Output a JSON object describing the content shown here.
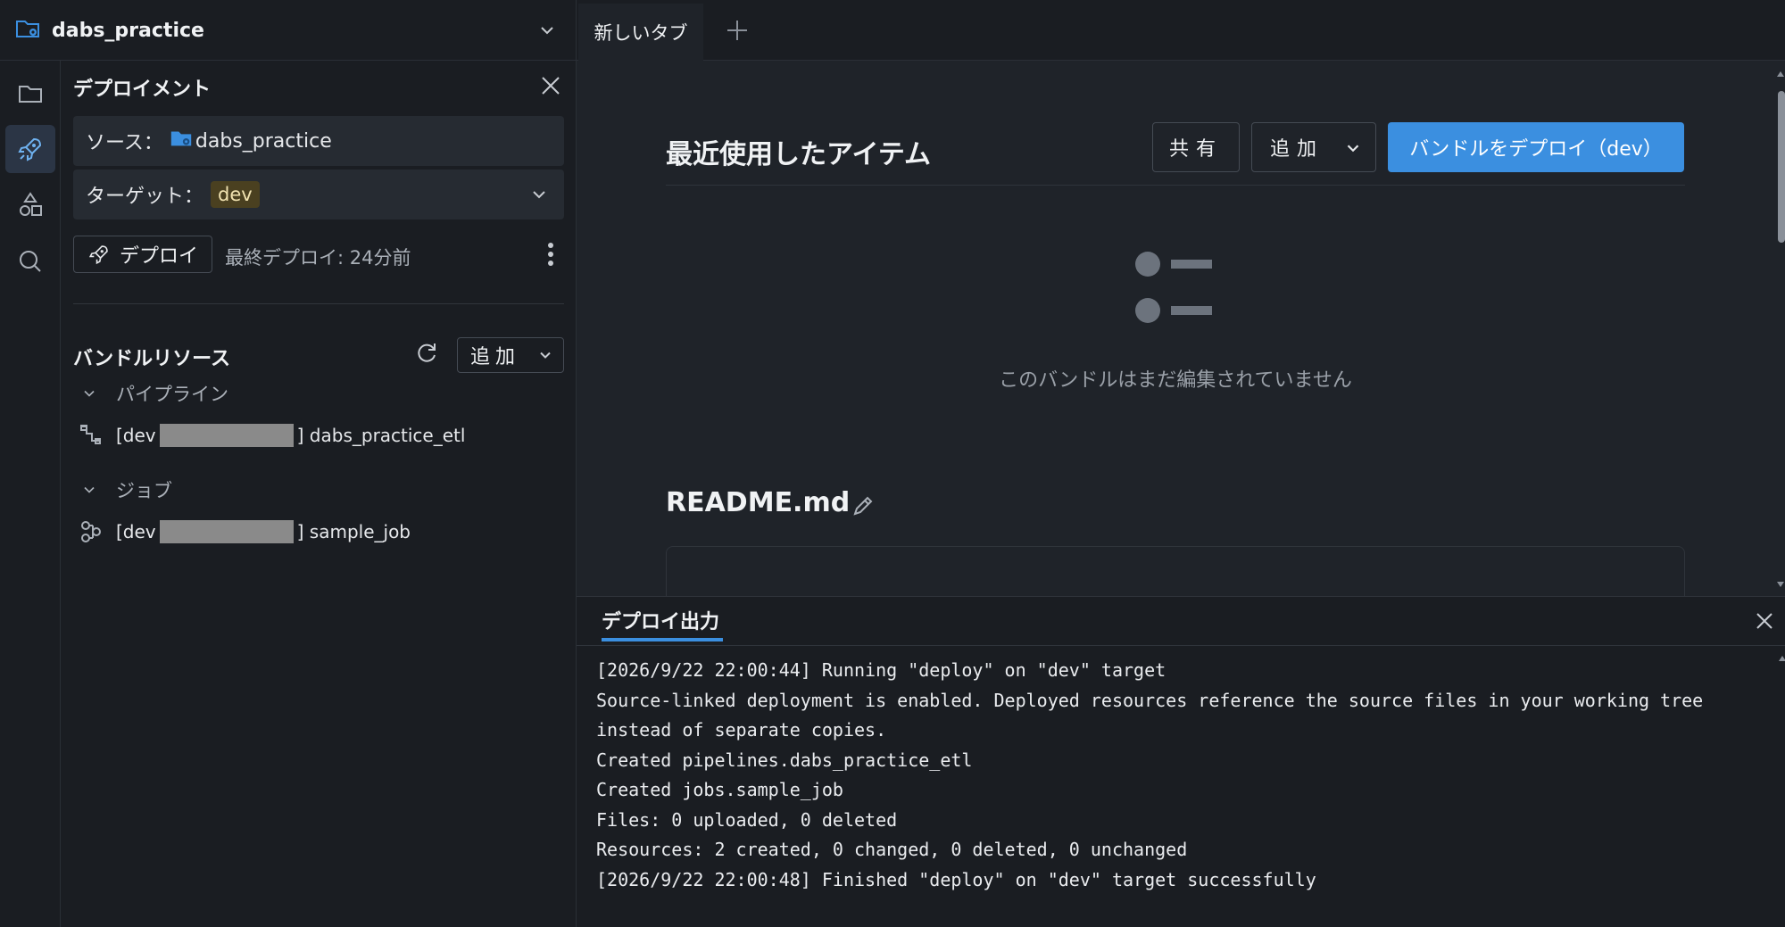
{
  "project": {
    "name": "dabs_practice"
  },
  "tabs": [
    {
      "label": "新しいタブ"
    }
  ],
  "panel": {
    "title": "デプロイメント",
    "source_label": "ソース：",
    "source_value": "dabs_practice",
    "target_label": "ターゲット：",
    "target_value": "dev",
    "deploy_button": "デプロイ",
    "last_deploy": "最終デプロイ: 24分前",
    "resources_title": "バンドルリソース",
    "add_button": "追加",
    "groups": [
      {
        "label": "パイプライン",
        "items": [
          {
            "prefix": "[dev",
            "suffix": "] dabs_practice_etl"
          }
        ]
      },
      {
        "label": "ジョブ",
        "items": [
          {
            "prefix": "[dev",
            "suffix": "] sample_job"
          }
        ]
      }
    ]
  },
  "main": {
    "title": "最近使用したアイテム",
    "share_button": "共有",
    "add_button": "追加",
    "deploy_button": "バンドルをデプロイ（dev）",
    "empty_text": "このバンドルはまだ編集されていません",
    "readme_title": "README.md"
  },
  "output": {
    "tab_label": "デプロイ出力",
    "lines": [
      "[2026/9/22 22:00:44] Running \"deploy\" on \"dev\" target",
      "Source-linked deployment is enabled. Deployed resources reference the source files in your working tree",
      "instead of separate copies.",
      "Created pipelines.dabs_practice_etl",
      "Created jobs.sample_job",
      "Files: 0 uploaded, 0 deleted",
      "Resources: 2 created, 0 changed, 0 deleted, 0 unchanged",
      "[2026/9/22 22:00:48] Finished \"deploy\" on \"dev\" target successfully"
    ]
  },
  "colors": {
    "accent": "#3b8fe0",
    "background": "#1f2329",
    "panel": "#1a1d22",
    "target_badge": "#4a4020"
  },
  "icons": {
    "project": "bundle-folder-icon",
    "rail": [
      "folder-icon",
      "rocket-icon",
      "shapes-icon",
      "search-icon"
    ],
    "pipeline": "pipeline-icon",
    "job": "job-icon"
  }
}
